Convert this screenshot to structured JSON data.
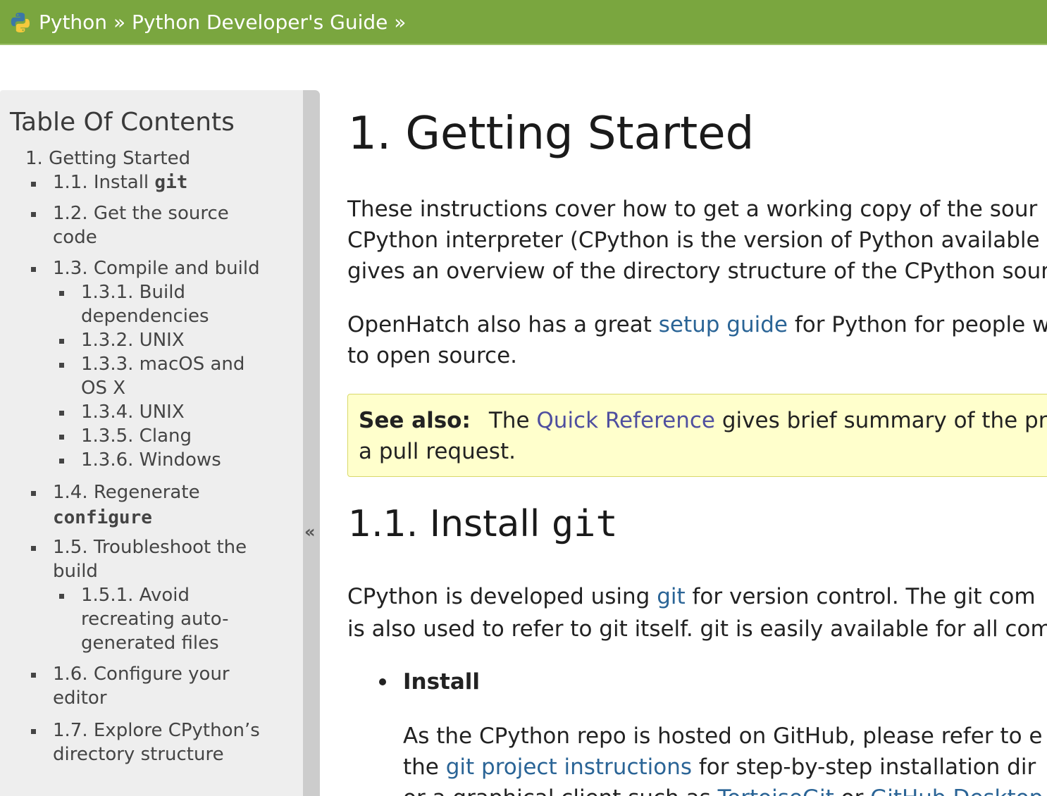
{
  "header": {
    "crumb_python": "Python",
    "crumb_sep1": "»",
    "crumb_guide": "Python Developer's Guide",
    "crumb_sep2": "»",
    "logo_icon": "python-logo-icon",
    "bar_color": "#7aa63f"
  },
  "sidebar": {
    "title": "Table Of Contents",
    "collapse_glyph": "«",
    "items": [
      {
        "text": "1. Getting Started"
      },
      {
        "text": "1.1. Install ",
        "code": "git"
      },
      {
        "text": "1.2. Get the source",
        "text2": "code"
      },
      {
        "text": "1.3. Compile and build"
      },
      {
        "text": "1.3.1. Build",
        "text2": "dependencies"
      },
      {
        "text": "1.3.2. UNIX"
      },
      {
        "text": "1.3.3. macOS and",
        "text2": "OS X"
      },
      {
        "text": "1.3.4. UNIX"
      },
      {
        "text": "1.3.5. Clang"
      },
      {
        "text": "1.3.6. Windows"
      },
      {
        "text": "1.4. Regenerate",
        "code": "configure"
      },
      {
        "text": "1.5. Troubleshoot the",
        "text2": "build"
      },
      {
        "text": "1.5.1. Avoid",
        "text2": "recreating auto-",
        "text3": "generated files"
      },
      {
        "text": "1.6. Configure your",
        "text2": "editor"
      },
      {
        "text": "1.7. Explore CPython’s",
        "text2": "directory structure"
      }
    ]
  },
  "main": {
    "title": "1. Getting Started",
    "intro": {
      "line1": "These instructions cover how to get a working copy of the sour",
      "line2": "CPython interpreter (CPython is the version of Python available f",
      "line3": "gives an overview of the directory structure of the CPython sourc"
    },
    "openhatch": {
      "before": "OpenHatch also has a great ",
      "link": "setup guide",
      "after": " for Python for people w",
      "line2": "to open source."
    },
    "see_also": {
      "label": "See also:",
      "before": "The ",
      "link": "Quick Reference",
      "after": " gives brief summary of the pro",
      "line2": "a pull request."
    },
    "section_title_text": "1.1. Install ",
    "section_title_code": "git",
    "git_para": {
      "before": "CPython is developed using ",
      "link": "git",
      "after": " for version control. The git com",
      "line2": "is also used to refer to git itself. git is easily available for all com"
    },
    "install": {
      "label": "Install",
      "line1": "As the CPython repo is hosted on GitHub, please refer to e",
      "line2_before": "the ",
      "line2_link": "git project instructions",
      "line2_after": " for step-by-step installation dir",
      "line3_before": "or a graphical client such as ",
      "line3_link1": "TortoiseGit",
      "line3_mid": " or ",
      "line3_link2": "GitHub Desktop"
    }
  }
}
